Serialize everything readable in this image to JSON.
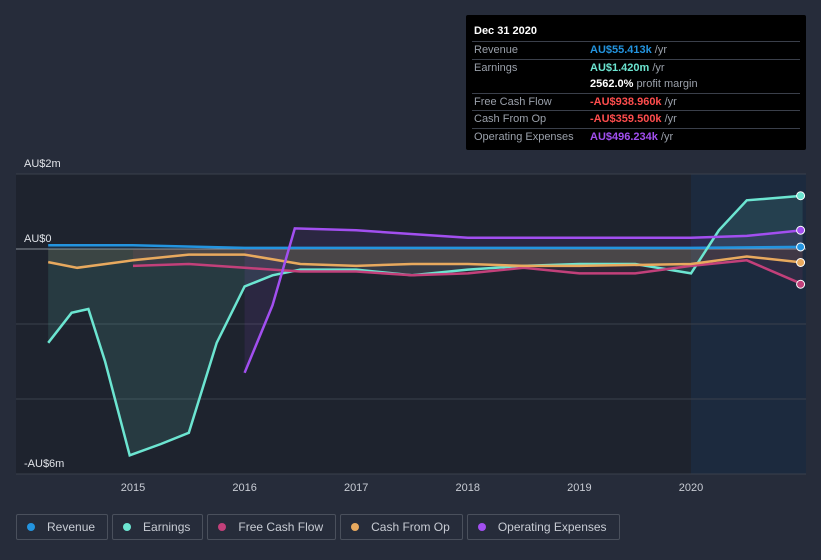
{
  "tooltip": {
    "date": "Dec 31 2020",
    "rows": [
      {
        "label": "Revenue",
        "value": "AU$55.413k",
        "unit": "/yr",
        "color": "#2394df"
      },
      {
        "label": "Earnings",
        "value": "AU$1.420m",
        "unit": "/yr",
        "color": "#6ce5d1"
      },
      {
        "label": "",
        "value": "2562.0%",
        "unit": "profit margin",
        "color": "#ffffff"
      },
      {
        "label": "Free Cash Flow",
        "value": "-AU$938.960k",
        "unit": "/yr",
        "color": "#ff4d4d"
      },
      {
        "label": "Cash From Op",
        "value": "-AU$359.500k",
        "unit": "/yr",
        "color": "#ff4d4d"
      },
      {
        "label": "Operating Expenses",
        "value": "AU$496.234k",
        "unit": "/yr",
        "color": "#a24ff0"
      }
    ]
  },
  "chart_data": {
    "type": "line",
    "ylim": [
      -6,
      2
    ],
    "xlim": [
      2014.0,
      2021.0
    ],
    "yticks": [
      {
        "v": 2,
        "label": "AU$2m"
      },
      {
        "v": 0,
        "label": "AU$0"
      },
      {
        "v": -6,
        "label": "-AU$6m"
      }
    ],
    "xticks": [
      "2015",
      "2016",
      "2017",
      "2018",
      "2019",
      "2020"
    ],
    "grid": true,
    "legend_placement": "bottom",
    "highlight_start": 2020.0,
    "series": [
      {
        "name": "Revenue",
        "color": "#2394df",
        "points": [
          [
            2014.24,
            0.1
          ],
          [
            2015,
            0.1
          ],
          [
            2016,
            0.03
          ],
          [
            2017,
            0.03
          ],
          [
            2018,
            0.03
          ],
          [
            2019,
            0.03
          ],
          [
            2020,
            0.03
          ],
          [
            2021,
            0.055
          ]
        ]
      },
      {
        "name": "Earnings",
        "color": "#6ce5d1",
        "points": [
          [
            2014.24,
            -2.5
          ],
          [
            2014.45,
            -1.7
          ],
          [
            2014.6,
            -1.6
          ],
          [
            2014.75,
            -3.0
          ],
          [
            2014.97,
            -5.5
          ],
          [
            2015.25,
            -5.2
          ],
          [
            2015.5,
            -4.9
          ],
          [
            2015.75,
            -2.5
          ],
          [
            2016.0,
            -1.0
          ],
          [
            2016.25,
            -0.7
          ],
          [
            2016.5,
            -0.55
          ],
          [
            2017,
            -0.55
          ],
          [
            2017.5,
            -0.7
          ],
          [
            2018,
            -0.55
          ],
          [
            2018.5,
            -0.45
          ],
          [
            2019,
            -0.4
          ],
          [
            2019.5,
            -0.4
          ],
          [
            2020,
            -0.65
          ],
          [
            2020.25,
            0.5
          ],
          [
            2020.5,
            1.3
          ],
          [
            2021,
            1.42
          ]
        ]
      },
      {
        "name": "Free Cash Flow",
        "color": "#c2407a",
        "points": [
          [
            2015,
            -0.45
          ],
          [
            2015.5,
            -0.4
          ],
          [
            2016,
            -0.5
          ],
          [
            2016.5,
            -0.6
          ],
          [
            2017,
            -0.6
          ],
          [
            2017.5,
            -0.7
          ],
          [
            2018,
            -0.65
          ],
          [
            2018.5,
            -0.5
          ],
          [
            2019,
            -0.65
          ],
          [
            2019.5,
            -0.65
          ],
          [
            2020,
            -0.45
          ],
          [
            2020.5,
            -0.3
          ],
          [
            2021,
            -0.94
          ]
        ]
      },
      {
        "name": "Cash From Op",
        "color": "#e8a95e",
        "points": [
          [
            2014.24,
            -0.35
          ],
          [
            2014.5,
            -0.5
          ],
          [
            2015,
            -0.3
          ],
          [
            2015.5,
            -0.15
          ],
          [
            2016,
            -0.15
          ],
          [
            2016.5,
            -0.4
          ],
          [
            2017,
            -0.45
          ],
          [
            2017.5,
            -0.4
          ],
          [
            2018,
            -0.4
          ],
          [
            2018.5,
            -0.45
          ],
          [
            2019,
            -0.45
          ],
          [
            2020,
            -0.4
          ],
          [
            2020.5,
            -0.2
          ],
          [
            2021,
            -0.36
          ]
        ]
      },
      {
        "name": "Operating Expenses",
        "color": "#a24ff0",
        "points": [
          [
            2016,
            -3.3
          ],
          [
            2016.25,
            -1.5
          ],
          [
            2016.45,
            0.55
          ],
          [
            2017,
            0.5
          ],
          [
            2018,
            0.3
          ],
          [
            2019,
            0.3
          ],
          [
            2020,
            0.3
          ],
          [
            2020.5,
            0.35
          ],
          [
            2021,
            0.5
          ]
        ]
      }
    ]
  }
}
